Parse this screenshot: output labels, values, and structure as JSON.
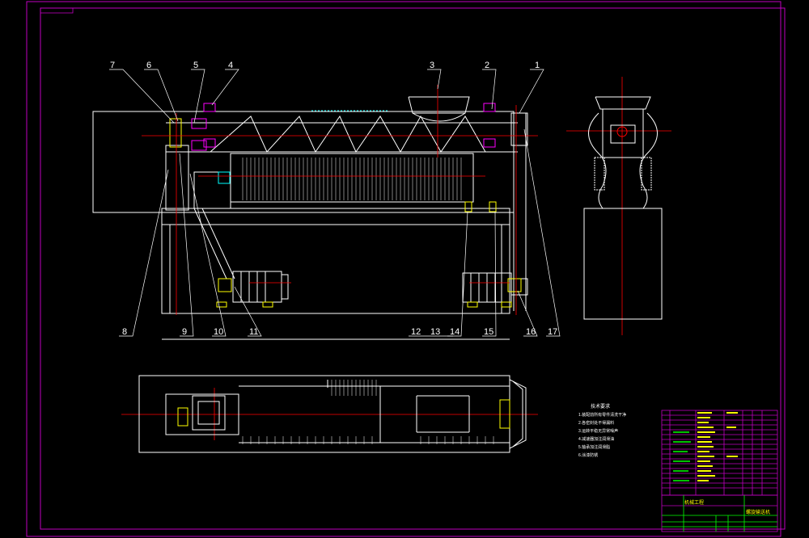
{
  "part_numbers": [
    "1",
    "2",
    "3",
    "4",
    "5",
    "6",
    "7",
    "8",
    "9",
    "10",
    "11",
    "12",
    "13",
    "14",
    "15",
    "16",
    "17"
  ],
  "notes": {
    "title": "技术要求",
    "lines": [
      "1.装配前所有零件清洗干净",
      "2.各密封处不得漏料",
      "3.运转平稳无异常噪声",
      "4.减速器加注润滑油",
      "5.轴承加注润滑脂",
      "6.涂漆防锈"
    ]
  },
  "title_block": {
    "drawing_name": "螺旋输送机",
    "company": "机械工程"
  },
  "colors": {
    "background": "#000000",
    "frame": "#c000c0",
    "outline": "#ffffff",
    "centerline": "#ff0000",
    "hidden": "#ffff00",
    "dim": "#00ff00",
    "cyan": "#00ffff"
  }
}
